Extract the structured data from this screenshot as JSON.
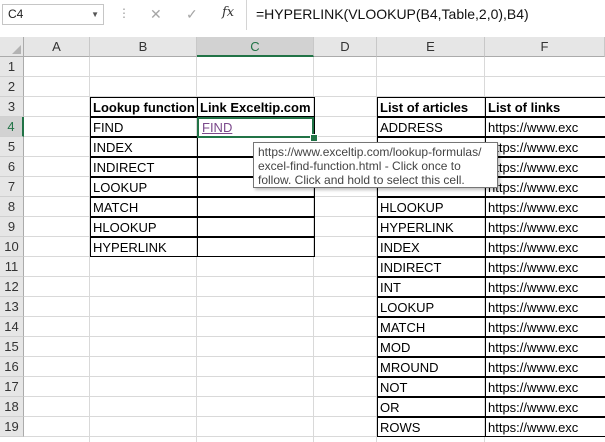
{
  "formula_bar": {
    "name_box": "C4",
    "cancel_icon": "✕",
    "enter_icon": "✓",
    "fx_label": "fx",
    "formula": "=HYPERLINK(VLOOKUP(B4,Table,2,0),B4)"
  },
  "columns": [
    "A",
    "B",
    "C",
    "D",
    "E",
    "F"
  ],
  "rows": [
    "1",
    "2",
    "3",
    "4",
    "5",
    "6",
    "7",
    "8",
    "9",
    "10",
    "11",
    "12",
    "13",
    "14",
    "15",
    "16",
    "17",
    "18",
    "19"
  ],
  "lookup_table": {
    "header_function": "Lookup function",
    "header_link": "Link Exceltip.com",
    "functions": [
      "FIND",
      "INDEX",
      "INDIRECT",
      "LOOKUP",
      "MATCH",
      "HLOOKUP",
      "HYPERLINK"
    ],
    "links": [
      "FIND",
      "",
      "",
      "",
      "",
      "",
      ""
    ]
  },
  "articles_table": {
    "header_articles": "List of articles",
    "header_links": "List of links",
    "articles": [
      "ADDRESS",
      "",
      "",
      "",
      "HLOOKUP",
      "HYPERLINK",
      "INDEX",
      "INDIRECT",
      "INT",
      "LOOKUP",
      "MATCH",
      "MOD",
      "MROUND",
      "NOT",
      "OR",
      "ROWS"
    ],
    "links": [
      "https://www.exc",
      "https://www.exc",
      "https://www.exc",
      "https://www.exc",
      "https://www.exc",
      "https://www.exc",
      "https://www.exc",
      "https://www.exc",
      "https://www.exc",
      "https://www.exc",
      "https://www.exc",
      "https://www.exc",
      "https://www.exc",
      "https://www.exc",
      "https://www.exc",
      "https://www.exc"
    ]
  },
  "tooltip": {
    "line1": "https://www.exceltip.com/lookup-formulas/",
    "line2": "excel-find-function.html - Click once to",
    "line3": "follow. Click and hold to select this cell."
  },
  "colors": {
    "selection": "#217346",
    "hyperlink_visited": "#7c4a8c",
    "header_bg": "#e6e6e6"
  }
}
